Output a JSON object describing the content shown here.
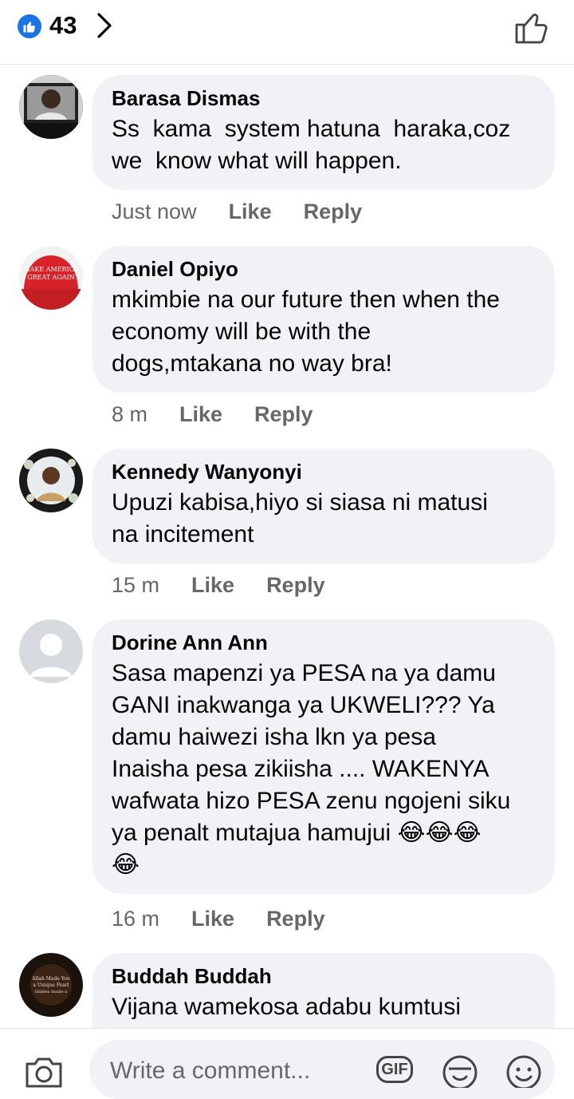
{
  "reactions": {
    "count": "43",
    "like_color": "#1b74e4"
  },
  "comments": [
    {
      "author": "Barasa Dismas",
      "text": "Ss  kama  system hatuna  haraka,coz\nwe  know what will happen.",
      "time": "Just now",
      "like": "Like",
      "reply": "Reply",
      "avatar": "photo"
    },
    {
      "author": "Daniel Opiyo",
      "text": "mkimbie na our future then when the\neconomy will be with the\ndogs,mtakana no way bra!",
      "time": "8 m",
      "like": "Like",
      "reply": "Reply",
      "avatar": "red-cap"
    },
    {
      "author": "Kennedy Wanyonyi",
      "text": "Upuzi kabisa,hiyo si siasa ni matusi\nna incitement",
      "time": "15 m",
      "like": "Like",
      "reply": "Reply",
      "avatar": "photo"
    },
    {
      "author": "Dorine Ann Ann",
      "text": "Sasa mapenzi ya PESA na ya damu\nGANI inakwanga ya UKWELI??? Ya\ndamu haiwezi isha lkn ya pesa\nInaisha pesa zikiisha .... WAKENYA\nwafwata hizo PESA zenu ngojeni siku\nya penalt mutajua hamujui 😂😂😂\n😂",
      "time": "16 m",
      "like": "Like",
      "reply": "Reply",
      "avatar": "default"
    },
    {
      "author": "Buddah Buddah",
      "text": "Vijana wamekosa adabu kumtusi",
      "avatar": "photo"
    }
  ],
  "composer": {
    "placeholder": "Write a comment...",
    "gif_label": "GIF"
  },
  "avatar_logo_texts": {
    "daniel_cap": "MAKE AMERICA GREAT AGAIN",
    "buddah_image": "Allah Made You a Unique Pearl Hidden Inside a Pretty Shell called Islam"
  }
}
